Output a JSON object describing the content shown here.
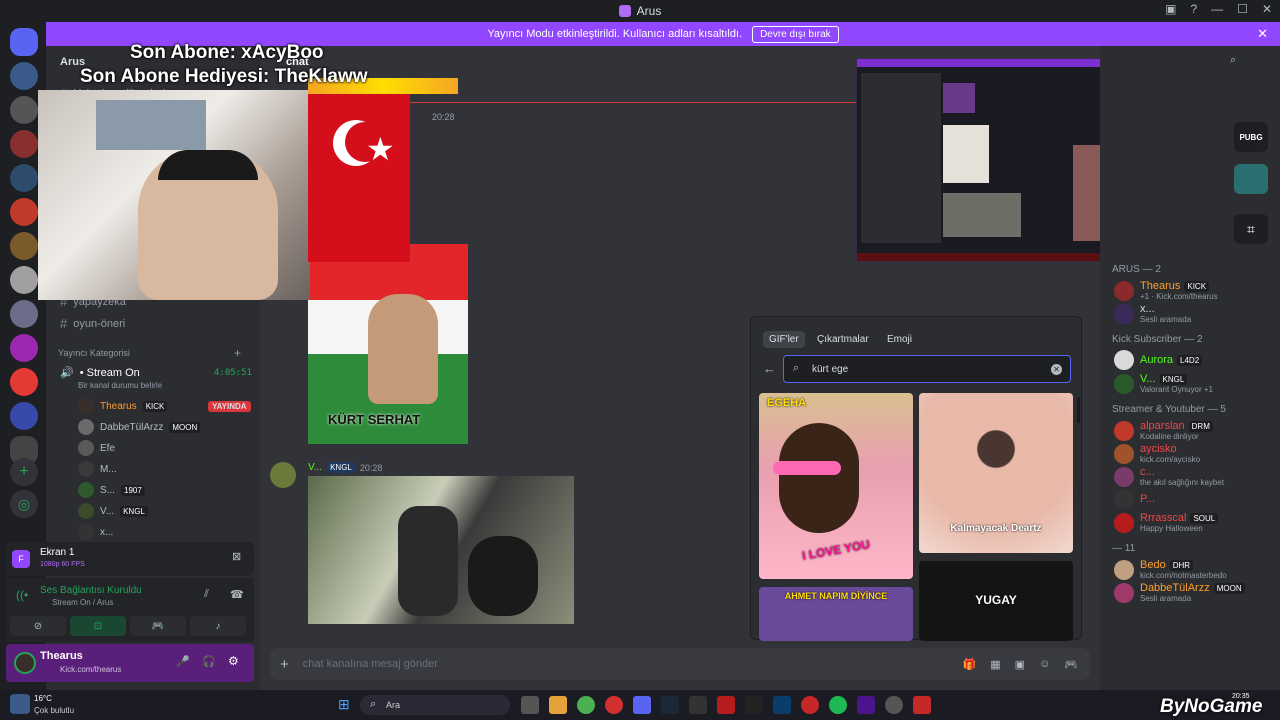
{
  "window": {
    "title": "Arus"
  },
  "banner": {
    "text": "Yayıncı Modu etkinleştirildi. Kullanıcı adları kısaltıldı.",
    "button": "Devre dışı bırak"
  },
  "server": {
    "name": "Arus",
    "current_channel": "chat",
    "top_channel": "kick-abonelik-rol-alma"
  },
  "overlay": {
    "last_sub": "Son Abone: xAcyBoo",
    "last_gift": "Son Abone Hediyesi: TheKlaww"
  },
  "channels": {
    "partial_channel": "yapayzeka",
    "oyun_oneri": "oyun-öneri",
    "category": "Yayıncı Kategorisi",
    "voice_channel": "• Stream On",
    "voice_timer": "4:05:51",
    "voice_status": "Bir kanal durumu belirle",
    "voice_users": [
      {
        "name": "Thearus",
        "badge": "KICK",
        "live": "YAYINDA",
        "color": "#ff9e2e"
      },
      {
        "name": "DabbeTülArzz",
        "badge": "MOON",
        "color": "#b5bac1"
      },
      {
        "name": "Efe",
        "badge": "",
        "color": "#b5bac1"
      },
      {
        "name": "M...",
        "badge": "",
        "color": "#b5bac1"
      },
      {
        "name": "S...",
        "badge": "1907",
        "color": "#b5bac1"
      },
      {
        "name": "V...",
        "badge": "KNGL",
        "color": "#b5bac1"
      },
      {
        "name": "x...",
        "badge": "",
        "color": "#b5bac1"
      }
    ]
  },
  "screen_share": {
    "title": "Ekran 1",
    "quality": "1080p 60 FPS"
  },
  "voice_connection": {
    "status": "Ses Bağlantısı Kuruldu",
    "channel": "Stream On / Arus"
  },
  "user_panel": {
    "name": "Thearus",
    "status": "Kick.com/thearus"
  },
  "messages": [
    {
      "time": "20:28"
    },
    {
      "user": "V...",
      "badge": "KNGL",
      "time": "20:28"
    }
  ],
  "image_caption": "KÜRT SERHAT",
  "gif_picker": {
    "tabs": [
      "GIF'ler",
      "Çıkartmalar",
      "Emoji"
    ],
    "search_value": "kürt ege",
    "gifs": [
      {
        "label": "EGEHA",
        "caption": "I LOVE YOU"
      },
      {
        "label": "",
        "caption": "Kalmayacak Deartz"
      },
      {
        "label": "AHMET NAPIM DİYİNCE",
        "caption": ""
      },
      {
        "label": "",
        "caption": "YUGAY"
      }
    ]
  },
  "composer": {
    "placeholder": "chat kanalına mesaj gönder"
  },
  "members": {
    "groups": [
      {
        "title": "ARUS — 2",
        "list": [
          {
            "name": "Thearus",
            "badge": "KICK",
            "sub": "+1 · Kick.com/thearus",
            "color": "#ff9e2e"
          },
          {
            "name": "x...",
            "badge": "",
            "sub": "Sesli aramada",
            "color": "#dbdee1"
          }
        ]
      },
      {
        "title": "Kick Subscriber — 2",
        "list": [
          {
            "name": "Aurora",
            "badge": "L4D2",
            "sub": "",
            "color": "#53fc18"
          },
          {
            "name": "V...",
            "badge": "KNGL",
            "sub": "Valorant Oynuyor +1",
            "color": "#53fc18"
          }
        ]
      },
      {
        "title": "Streamer & Youtuber — 5",
        "list": [
          {
            "name": "alparslan",
            "badge": "DRM",
            "sub": "Kodaline dinliyor",
            "color": "#f04747"
          },
          {
            "name": "aycisko",
            "badge": "",
            "sub": "kick.com/aycisko",
            "color": "#f04747"
          },
          {
            "name": "c...",
            "badge": "",
            "sub": "the akıl sağlığını kaybet",
            "color": "#f04747"
          },
          {
            "name": "P...",
            "badge": "",
            "sub": "",
            "color": "#f04747"
          },
          {
            "name": "Rrrasscal",
            "badge": "SOUL",
            "sub": "Happy Halloween",
            "color": "#f04747"
          }
        ]
      },
      {
        "title": "— 11",
        "list": [
          {
            "name": "Bedo",
            "badge": "DHR",
            "sub": "kick.com/notmasterbedo",
            "color": "#ff9e2e"
          },
          {
            "name": "DabbeTülArzz",
            "badge": "MOON",
            "sub": "Sesli aramada",
            "color": "#ff9e2e"
          }
        ]
      }
    ]
  },
  "taskbar": {
    "weather_temp": "16°C",
    "weather_desc": "Çok bulutlu",
    "search": "Ara",
    "clock": "20:35",
    "watermark": "ByNoGame"
  },
  "colors": {
    "accent": "#9146ff",
    "kick": "#53fc18",
    "live": "#da373c",
    "blurple": "#5865f2"
  }
}
